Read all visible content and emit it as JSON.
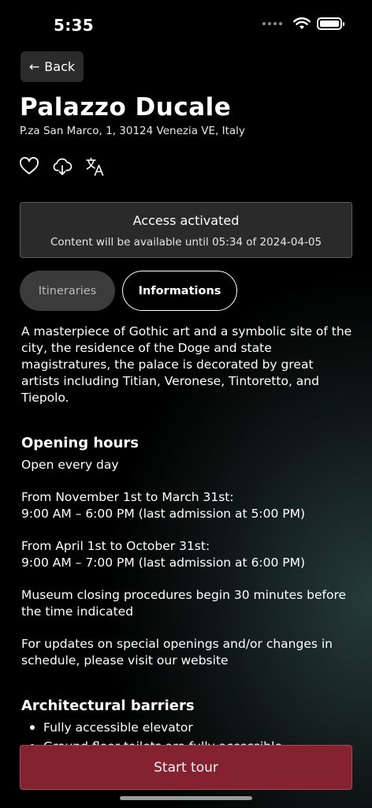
{
  "status_bar": {
    "time": "5:35"
  },
  "back_button": {
    "label": "Back"
  },
  "place": {
    "title": "Palazzo Ducale",
    "address": "P.za San Marco, 1, 30124 Venezia VE, Italy"
  },
  "actions": {
    "icons": [
      "heart-icon",
      "cloud-download-icon",
      "translate-icon"
    ]
  },
  "access": {
    "title": "Access activated",
    "subtitle": "Content will be available until 05:34 of 2024-04-05"
  },
  "tabs": [
    {
      "label": "Itineraries",
      "selected": false
    },
    {
      "label": "Informations",
      "selected": true
    }
  ],
  "content": {
    "description": "A masterpiece of Gothic art and a symbolic site of the city, the residence of the Doge and state magistratures, the palace is decorated by great artists including Titian, Veronese, Tintoretto, and Tiepolo.",
    "opening_hours": {
      "heading": "Opening hours",
      "open_every_day": "Open every day",
      "winter_title": "From November 1st to March 31st:",
      "winter_hours": "9:00 AM – 6:00 PM (last admission at 5:00 PM)",
      "summer_title": "From April 1st to October 31st:",
      "summer_hours": "9:00 AM – 7:00 PM (last admission at 6:00 PM)",
      "closing_note": "Museum closing procedures begin 30 minutes before the time indicated",
      "updates_note": "For updates on special openings and/or changes in schedule, please visit our website"
    },
    "barriers": {
      "heading": "Architectural barriers",
      "items": [
        "Fully accessible elevator",
        "Ground floor toilets are fully accessible"
      ]
    }
  },
  "start_tour": {
    "label": "Start tour"
  },
  "colors": {
    "accent": "#842231",
    "background": "#000000",
    "panel": "#2a2a2a"
  }
}
